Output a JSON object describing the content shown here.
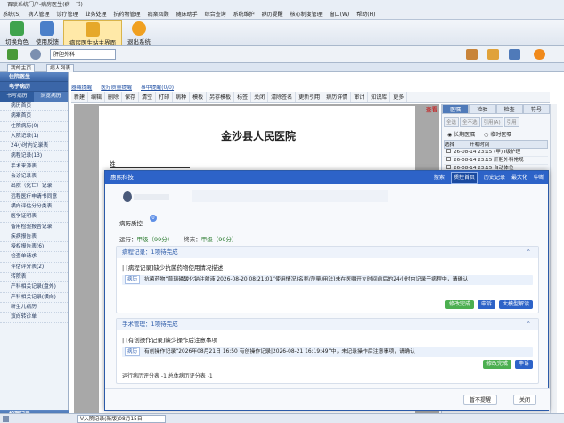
{
  "window": {
    "title": "百联系统门户-病房医生(病一书)"
  },
  "menu": [
    "系统(S)",
    "病人管理",
    "诊疗管理",
    "业务处理",
    "抗药物管理",
    "病案回顾",
    "随床助手",
    "综合查询",
    "系统维护",
    "病历提醒",
    "核心制度管理",
    "窗口(W)",
    "帮助(H)"
  ],
  "toolbar": {
    "buttons": [
      "切换角色",
      "使用反馈",
      "病房医生站主界面",
      "退出系统"
    ]
  },
  "secbar": {
    "dept": "肝胆外科"
  },
  "tabs": [
    "我的主页",
    "病人列表"
  ],
  "sidebar": {
    "header": "住院医生",
    "sub1": "电子病历",
    "subtabs": [
      "书写病历",
      "浏览病历"
    ],
    "items": [
      "病历首页",
      "病案首页",
      "住院病历(0)",
      "入院记录(1)",
      "24小时内记录表",
      "病程记录(13)",
      "手术来源表",
      "会诊记录表",
      "出院（死亡）记录",
      "远程医疗申请书同意",
      "横向评估分分类表",
      "医学证明表",
      "备用检验报告记录",
      "疾病报告表",
      "授权报告表(6)",
      "检查单请求",
      "评估评分表(2)",
      "转院表",
      "产科相关记录(盘外)",
      "产科相关记录(横向)",
      "新生儿病历",
      "双向转诊单"
    ],
    "footer": "护理记录"
  },
  "links": [
    "器械提醒",
    "医疗质量提醒",
    "事中提醒(0/0)"
  ],
  "editor_toolbar": [
    "新建",
    "编辑",
    "删除",
    "保存",
    "清空",
    "打印",
    "病种",
    "模板",
    "另存模板",
    "标签",
    "关闭",
    "清除签名",
    "更新引用",
    "病历详情",
    "审计",
    "知识库",
    "更多"
  ],
  "stamp": "查看",
  "document": {
    "hospital": "金沙县人民医院",
    "field": "姓"
  },
  "right_panel": {
    "tabs": [
      "医嘱",
      "检验",
      "检查",
      "符号"
    ],
    "buttons": [
      "全选",
      "全不选",
      "引用(A)",
      "引用"
    ],
    "radios": [
      "长期医嘱",
      "临时医嘱"
    ],
    "columns": [
      "选择",
      "开嘱时间"
    ],
    "rows": [
      {
        "time": "26-08-14 23:15",
        "text": "(甲) I级护理"
      },
      {
        "time": "26-08-14 23:15",
        "text": "肝胆外科常规"
      },
      {
        "time": "26-08-14 23:15",
        "text": "自动体位"
      }
    ]
  },
  "dialog": {
    "brand": "惠熙科技",
    "actions": [
      "搜索",
      "质控首页",
      "历史记录",
      "最大化",
      "中断"
    ],
    "quality_label": "病历质控",
    "quality_count": "0",
    "grades": {
      "run_label": "运行：",
      "run": "甲级（99分）",
      "final_label": "终末：",
      "final": "甲级（99分）"
    },
    "sections": [
      {
        "head": "病程记录：1项待完成",
        "title": "| [病程记录]缺少抗菌药物使用情况描述",
        "tag": "病历",
        "desc": "抗菌药物“普瑞磷酸化钠注射液 2026-08-20 08:21:01”使用情况(名称/剂量/用法)未在医嘱开立时间前后的24小时内记录于病程中，请确认",
        "buttons": [
          "修改完成",
          "申诉",
          "大模型解读"
        ]
      },
      {
        "head": "手术管理：1项待完成",
        "title": "| [有创操作记录]缺少操作后注意事项",
        "tag": "病历",
        "desc": "有创操作记录“2026年08月21日 16:50 有创操作记录|2026-08-21 16:19:49”中，未记录操作后注意事项，请确认",
        "buttons": [
          "修改完成",
          "申诉"
        ]
      }
    ],
    "scores": "运行病历评分表 -1    总体病历评分表 -1",
    "footer_buttons": [
      "暂不提醒",
      "关闭"
    ]
  },
  "status": {
    "tab": "V入院记录(新版)08月15日"
  }
}
